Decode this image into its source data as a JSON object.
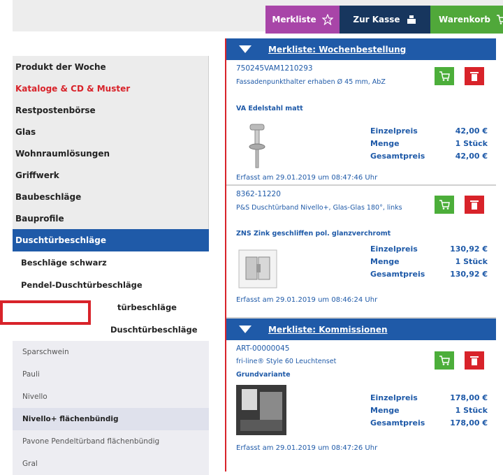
{
  "topbar": {
    "merkliste": "Merkliste",
    "kasse": "Zur Kasse",
    "warenkorb": "Warenkorb"
  },
  "sidebar": {
    "main": [
      {
        "label": "Produkt der Woche",
        "highlight": false
      },
      {
        "label": "Kataloge & CD & Muster",
        "highlight": true
      },
      {
        "label": "Restpostenbörse",
        "highlight": false
      },
      {
        "label": "Glas",
        "highlight": false
      },
      {
        "label": "Wohnraumlösungen",
        "highlight": false
      },
      {
        "label": "Griffwerk",
        "highlight": false
      },
      {
        "label": "Baubeschläge",
        "highlight": false
      },
      {
        "label": "Bauprofile",
        "highlight": false
      }
    ],
    "active": "Duschtürbeschläge",
    "sub": [
      "Beschläge schwarz",
      "Pendel-Duschtürbeschläge",
      "türbeschläge",
      "Duschtürbeschläge"
    ],
    "third": [
      {
        "label": "Sparschwein",
        "selected": false
      },
      {
        "label": "Pauli",
        "selected": false
      },
      {
        "label": "Nivello",
        "selected": false
      },
      {
        "label": "Nivello+ flächenbündig",
        "selected": true
      },
      {
        "label": "Pavone Pendeltürband flächenbündig",
        "selected": false
      },
      {
        "label": "Gral",
        "selected": false
      }
    ]
  },
  "lists": [
    {
      "title": "Merkliste: Wochenbestellung",
      "items": [
        {
          "art": "750245VAM1210293",
          "name": "Fassadenpunkthalter erhaben Ø 45 mm, AbZ",
          "variant": "VA Edelstahl matt",
          "einzelpreis_label": "Einzelpreis",
          "einzelpreis": "42,00 €",
          "menge_label": "Menge",
          "menge": "1 Stück",
          "gesamtpreis_label": "Gesamtpreis",
          "gesamtpreis": "42,00 €",
          "erfasst": "Erfasst am  29.01.2019  um  08:47:46  Uhr"
        },
        {
          "art": "8362-11220",
          "name": "P&S Duschtürband Nivello+, Glas-Glas 180°, links",
          "variant": "ZNS Zink geschliffen pol. glanzverchromt",
          "einzelpreis_label": "Einzelpreis",
          "einzelpreis": "130,92 €",
          "menge_label": "Menge",
          "menge": "1 Stück",
          "gesamtpreis_label": "Gesamtpreis",
          "gesamtpreis": "130,92 €",
          "erfasst": "Erfasst am  29.01.2019  um  08:46:24  Uhr"
        }
      ]
    },
    {
      "title": "Merkliste: Kommissionen",
      "items": [
        {
          "art": "ART-00000045",
          "name": "fri-line® Style 60 Leuchtenset",
          "variant": "Grundvariante",
          "einzelpreis_label": "Einzelpreis",
          "einzelpreis": "178,00 €",
          "menge_label": "Menge",
          "menge": "1 Stück",
          "gesamtpreis_label": "Gesamtpreis",
          "gesamtpreis": "178,00 €",
          "erfasst": "Erfasst am  29.01.2019  um  08:47:26  Uhr"
        }
      ]
    }
  ]
}
